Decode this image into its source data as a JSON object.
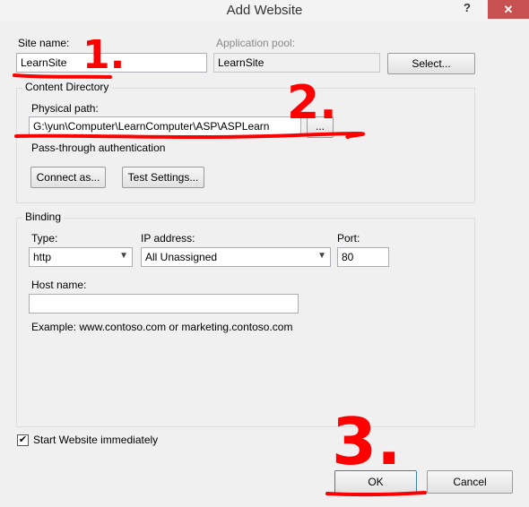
{
  "window": {
    "title": "Add Website",
    "help_label": "?",
    "close_label": "✕"
  },
  "site": {
    "label": "Site name:",
    "value": "LearnSite"
  },
  "app_pool": {
    "label": "Application pool:",
    "value": "LearnSite",
    "select_label": "Select..."
  },
  "content_directory": {
    "title": "Content Directory",
    "physical_path_label": "Physical path:",
    "physical_path_value": "G:\\yun\\Computer\\LearnComputer\\ASP\\ASPLearn",
    "browse_label": "...",
    "passthrough_label": "Pass-through authentication",
    "connect_as_label": "Connect as...",
    "test_settings_label": "Test Settings..."
  },
  "binding": {
    "title": "Binding",
    "type_label": "Type:",
    "type_value": "http",
    "ip_label": "IP address:",
    "ip_value": "All Unassigned",
    "port_label": "Port:",
    "port_value": "80",
    "host_label": "Host name:",
    "host_value": "",
    "example_text": "Example: www.contoso.com or marketing.contoso.com"
  },
  "start_immediately": {
    "label": "Start Website immediately",
    "checked": true
  },
  "footer": {
    "ok_label": "OK",
    "cancel_label": "Cancel"
  },
  "annotations": {
    "one": "1.",
    "two": "2.",
    "three": "3.",
    "color": "#ff0000"
  }
}
